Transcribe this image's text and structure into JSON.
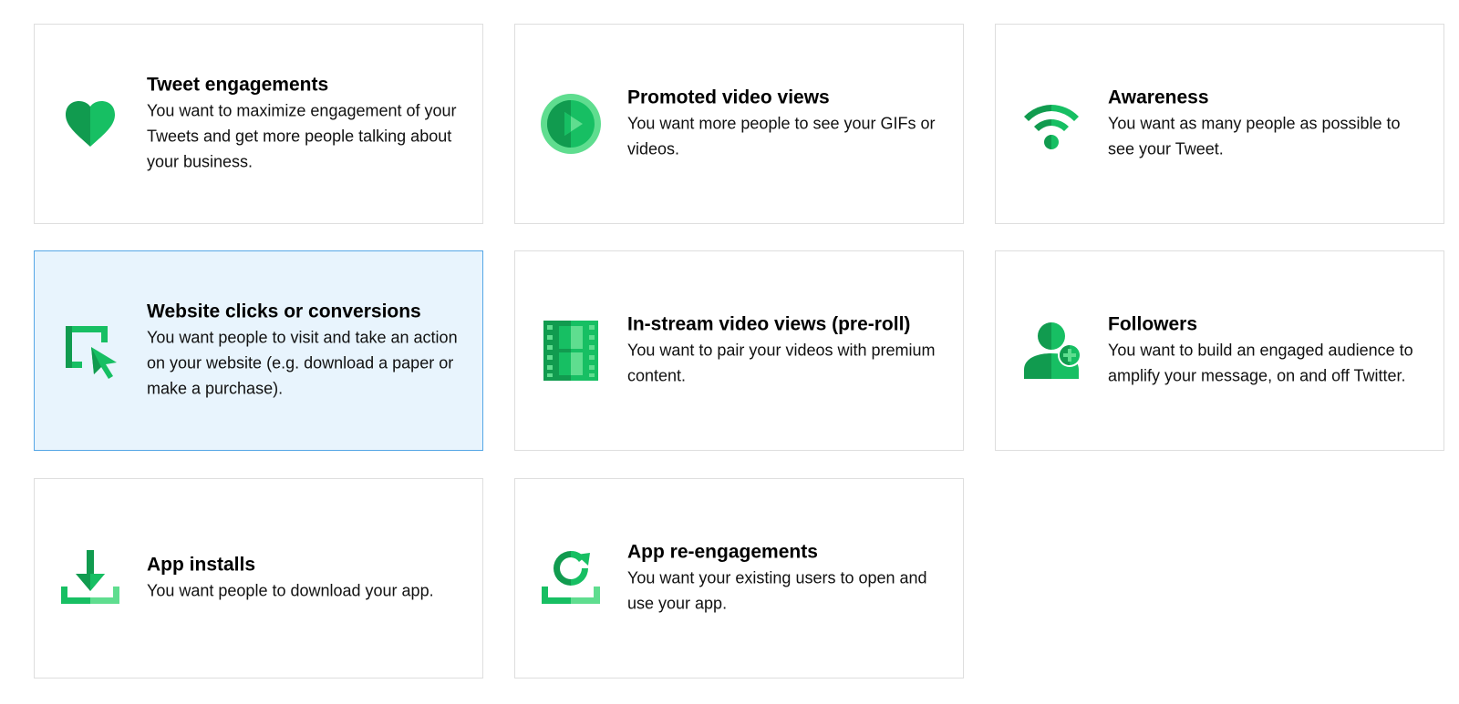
{
  "colors": {
    "green_dark": "#119b4f",
    "green_mid": "#17bf63",
    "green_light": "#5fdd8f",
    "selected_background": "#e8f4fd",
    "selected_border": "#56a7e6",
    "card_border": "#dedede"
  },
  "objectives": [
    {
      "icon": "heart-icon",
      "title": "Tweet engagements",
      "description": "You want to maximize engagement of your Tweets and get more people talking about your business.",
      "selected": false
    },
    {
      "icon": "play-video-icon",
      "title": "Promoted video views",
      "description": "You want more people to see your GIFs or videos.",
      "selected": false
    },
    {
      "icon": "wifi-signal-icon",
      "title": "Awareness",
      "description": "You want as many people as possible to see your Tweet.",
      "selected": false
    },
    {
      "icon": "cursor-click-icon",
      "title": "Website clicks or conversions",
      "description": "You want people to visit and take an action on your website (e.g. download a paper or make a purchase).",
      "selected": true
    },
    {
      "icon": "film-strip-icon",
      "title": "In-stream video views (pre-roll)",
      "description": "You want to pair your videos with premium content.",
      "selected": false
    },
    {
      "icon": "add-follower-icon",
      "title": "Followers",
      "description": "You want to build an engaged audience to amplify your message, on and off Twitter.",
      "selected": false
    },
    {
      "icon": "download-icon",
      "title": "App installs",
      "description": "You want people to download your app.",
      "selected": false
    },
    {
      "icon": "refresh-icon",
      "title": "App re-engagements",
      "description": "You want your existing users to open and use your app.",
      "selected": false
    }
  ]
}
